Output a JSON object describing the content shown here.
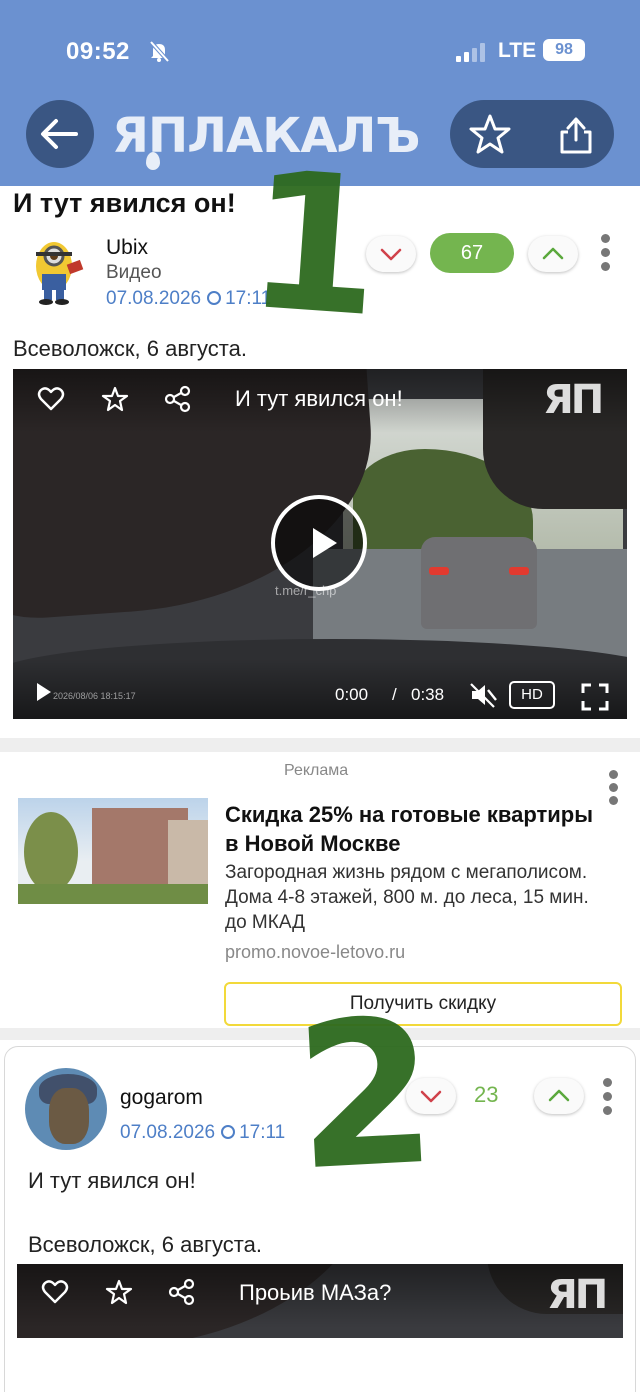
{
  "status_bar": {
    "time": "09:52",
    "network": "LTE",
    "battery": "98"
  },
  "header": {
    "logo_text": "ЯПЛАКАЛЪ"
  },
  "post": {
    "title": "И тут явился он!",
    "author": "Ubix",
    "category": "Видео",
    "date": "07.08.2026",
    "time": "17:11",
    "rating": "67",
    "text": "Всеволожск, 6 августа.",
    "video": {
      "title": "И тут явился он!",
      "watermark": "t.me/r_chp",
      "timestamp_overlay": "2026/08/06   18:15:17",
      "current_time": "0:00",
      "separator": "/",
      "duration": "0:38",
      "hd_label": "HD",
      "logo": "ЯП"
    }
  },
  "ad": {
    "label": "Реклама",
    "title": "Скидка 25% на готовые квартиры в Новой Москве",
    "description": "Загородная жизнь рядом с мегаполисом. Дома 4-8 этажей, 800 м. до леса, 15 мин. до МКАД",
    "url": "promo.novoe-letovo.ru",
    "button_label": "Получить скидку"
  },
  "comment": {
    "author": "gogarom",
    "date": "07.08.2026",
    "time": "17:11",
    "rating": "23",
    "text_line1": "И тут явился он!",
    "text_line2": "Всеволожск, 6 августа.",
    "video": {
      "title": "Проьив МАЗа?",
      "logo": "ЯП"
    }
  },
  "annotations": {
    "mark1": "1",
    "mark2": "2"
  },
  "colors": {
    "header_bg": "#6b91d0",
    "rating_green": "#74b54f",
    "link_blue": "#4e7fc7",
    "ad_button_border": "#f2d93a"
  }
}
